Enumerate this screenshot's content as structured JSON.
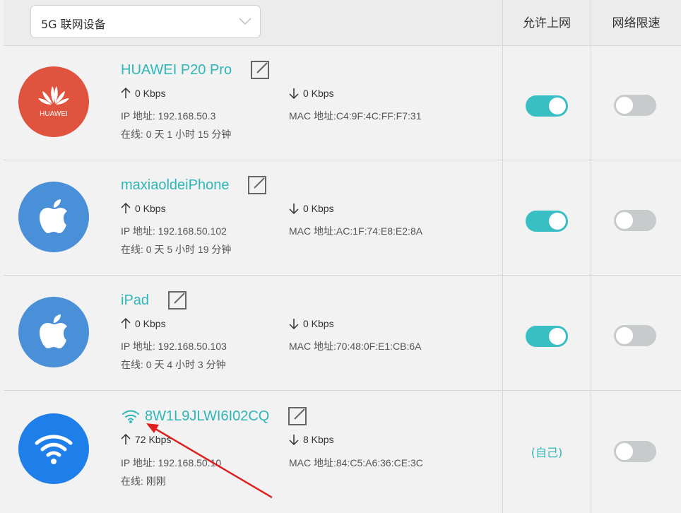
{
  "header": {
    "dropdown_value": "5G 联网设备",
    "col_allow": "允许上网",
    "col_limit": "网络限速"
  },
  "colors": {
    "accent": "#2fb6b8",
    "toggle_on": "#38bfc3",
    "toggle_off": "#c7cbcc",
    "huawei": "#e0533f",
    "apple": "#4a90d9",
    "wifi": "#1e7fea",
    "arrow": "#e02020"
  },
  "devices": [
    {
      "name": "HUAWEI P20 Pro",
      "icon": "huawei-logo",
      "logo_text": "HUAWEI",
      "up": "0 Kbps",
      "down": "0 Kbps",
      "ip": "IP 地址: 192.168.50.3",
      "mac": "MAC 地址:C4:9F:4C:FF:F7:31",
      "online": "在线: 0 天 1 小时 15 分钟",
      "allow": true,
      "limit": false
    },
    {
      "name": "maxiaoldeiPhone",
      "icon": "apple-logo",
      "up": "0 Kbps",
      "down": "0 Kbps",
      "ip": "IP 地址: 192.168.50.102",
      "mac": "MAC 地址:AC:1F:74:E8:E2:8A",
      "online": "在线: 0 天 5 小时 19 分钟",
      "allow": true,
      "limit": false
    },
    {
      "name": "iPad",
      "icon": "apple-logo",
      "up": "0 Kbps",
      "down": "0 Kbps",
      "ip": "IP 地址: 192.168.50.103",
      "mac": "MAC 地址:70:48:0F:E1:CB:6A",
      "online": "在线: 0 天 4 小时 3 分钟",
      "allow": true,
      "limit": false
    },
    {
      "name": "8W1L9JLWI6I02CQ",
      "icon": "wifi-logo",
      "up": "72 Kbps",
      "down": "8 Kbps",
      "ip": "IP 地址: 192.168.50.10",
      "mac": "MAC 地址:84:C5:A6:36:CE:3C",
      "online": "在线: 刚刚",
      "allow_label": "(自己)",
      "limit": false
    }
  ]
}
